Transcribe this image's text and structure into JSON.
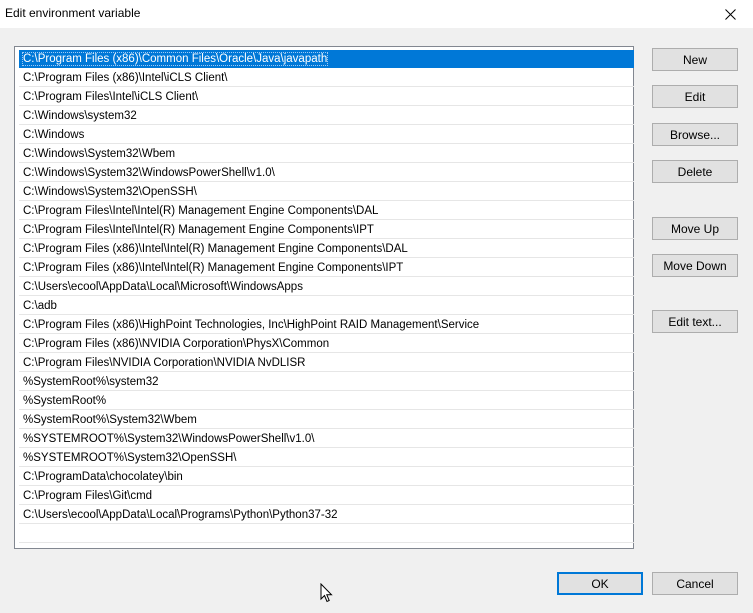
{
  "window": {
    "title": "Edit environment variable"
  },
  "paths": [
    "C:\\Program Files (x86)\\Common Files\\Oracle\\Java\\javapath",
    "C:\\Program Files (x86)\\Intel\\iCLS Client\\",
    "C:\\Program Files\\Intel\\iCLS Client\\",
    "C:\\Windows\\system32",
    "C:\\Windows",
    "C:\\Windows\\System32\\Wbem",
    "C:\\Windows\\System32\\WindowsPowerShell\\v1.0\\",
    "C:\\Windows\\System32\\OpenSSH\\",
    "C:\\Program Files\\Intel\\Intel(R) Management Engine Components\\DAL",
    "C:\\Program Files\\Intel\\Intel(R) Management Engine Components\\IPT",
    "C:\\Program Files (x86)\\Intel\\Intel(R) Management Engine Components\\DAL",
    "C:\\Program Files (x86)\\Intel\\Intel(R) Management Engine Components\\IPT",
    "C:\\Users\\ecool\\AppData\\Local\\Microsoft\\WindowsApps",
    "C:\\adb",
    "C:\\Program Files (x86)\\HighPoint Technologies, Inc\\HighPoint RAID Management\\Service",
    "C:\\Program Files (x86)\\NVIDIA Corporation\\PhysX\\Common",
    "C:\\Program Files\\NVIDIA Corporation\\NVIDIA NvDLISR",
    "%SystemRoot%\\system32",
    "%SystemRoot%",
    "%SystemRoot%\\System32\\Wbem",
    "%SYSTEMROOT%\\System32\\WindowsPowerShell\\v1.0\\",
    "%SYSTEMROOT%\\System32\\OpenSSH\\",
    "C:\\ProgramData\\chocolatey\\bin",
    "C:\\Program Files\\Git\\cmd",
    "C:\\Users\\ecool\\AppData\\Local\\Programs\\Python\\Python37-32"
  ],
  "selected_index": 0,
  "buttons": {
    "new": "New",
    "edit": "Edit",
    "browse": "Browse...",
    "delete": "Delete",
    "move_up": "Move Up",
    "move_down": "Move Down",
    "edit_text": "Edit text...",
    "ok": "OK",
    "cancel": "Cancel"
  },
  "icons": {
    "close": "close-icon",
    "cursor": "mouse-pointer-icon"
  },
  "colors": {
    "selection": "#0078d7",
    "background": "#f0f0f0",
    "button": "#e1e1e1"
  }
}
